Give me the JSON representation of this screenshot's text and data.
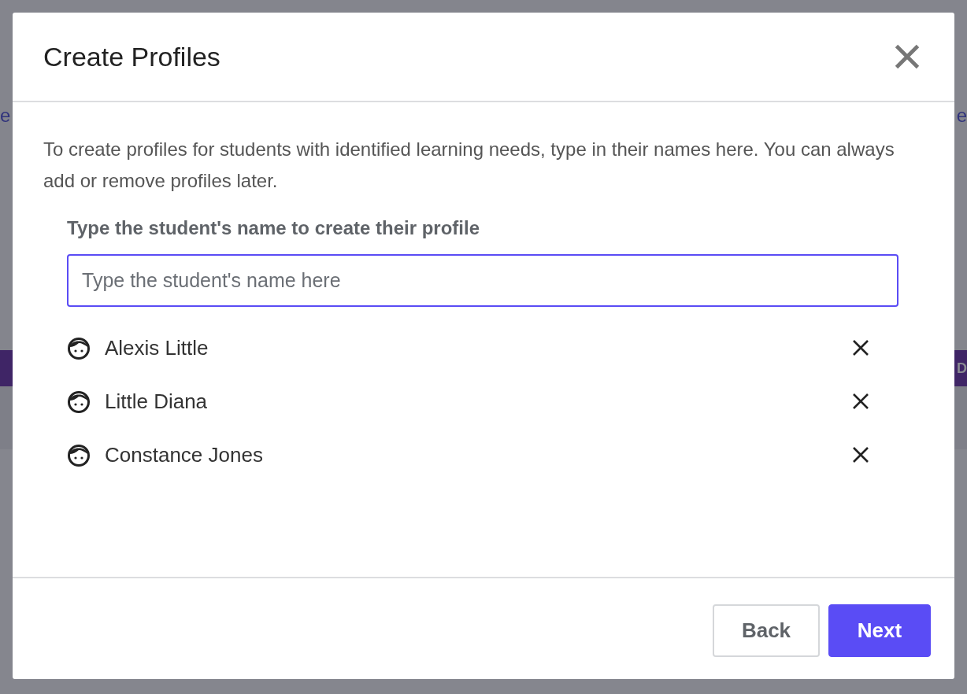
{
  "background": {
    "left_fragment": "e",
    "right_fragment": "e",
    "banner_fragment": "D"
  },
  "dialog": {
    "title": "Create Profiles",
    "intro": "To create profiles for students with identified learning needs, type in their names here. You can always add or remove profiles later.",
    "field_label": "Type the student's name to create their profile",
    "field": {
      "placeholder": "Type the student's name here",
      "focused": true
    },
    "students": [
      {
        "name": "Alexis Little"
      },
      {
        "name": "Little Diana"
      },
      {
        "name": "Constance Jones"
      }
    ],
    "buttons": [
      {
        "label": "Back",
        "kind": "secondary"
      },
      {
        "label": "Next",
        "kind": "primary"
      }
    ]
  }
}
